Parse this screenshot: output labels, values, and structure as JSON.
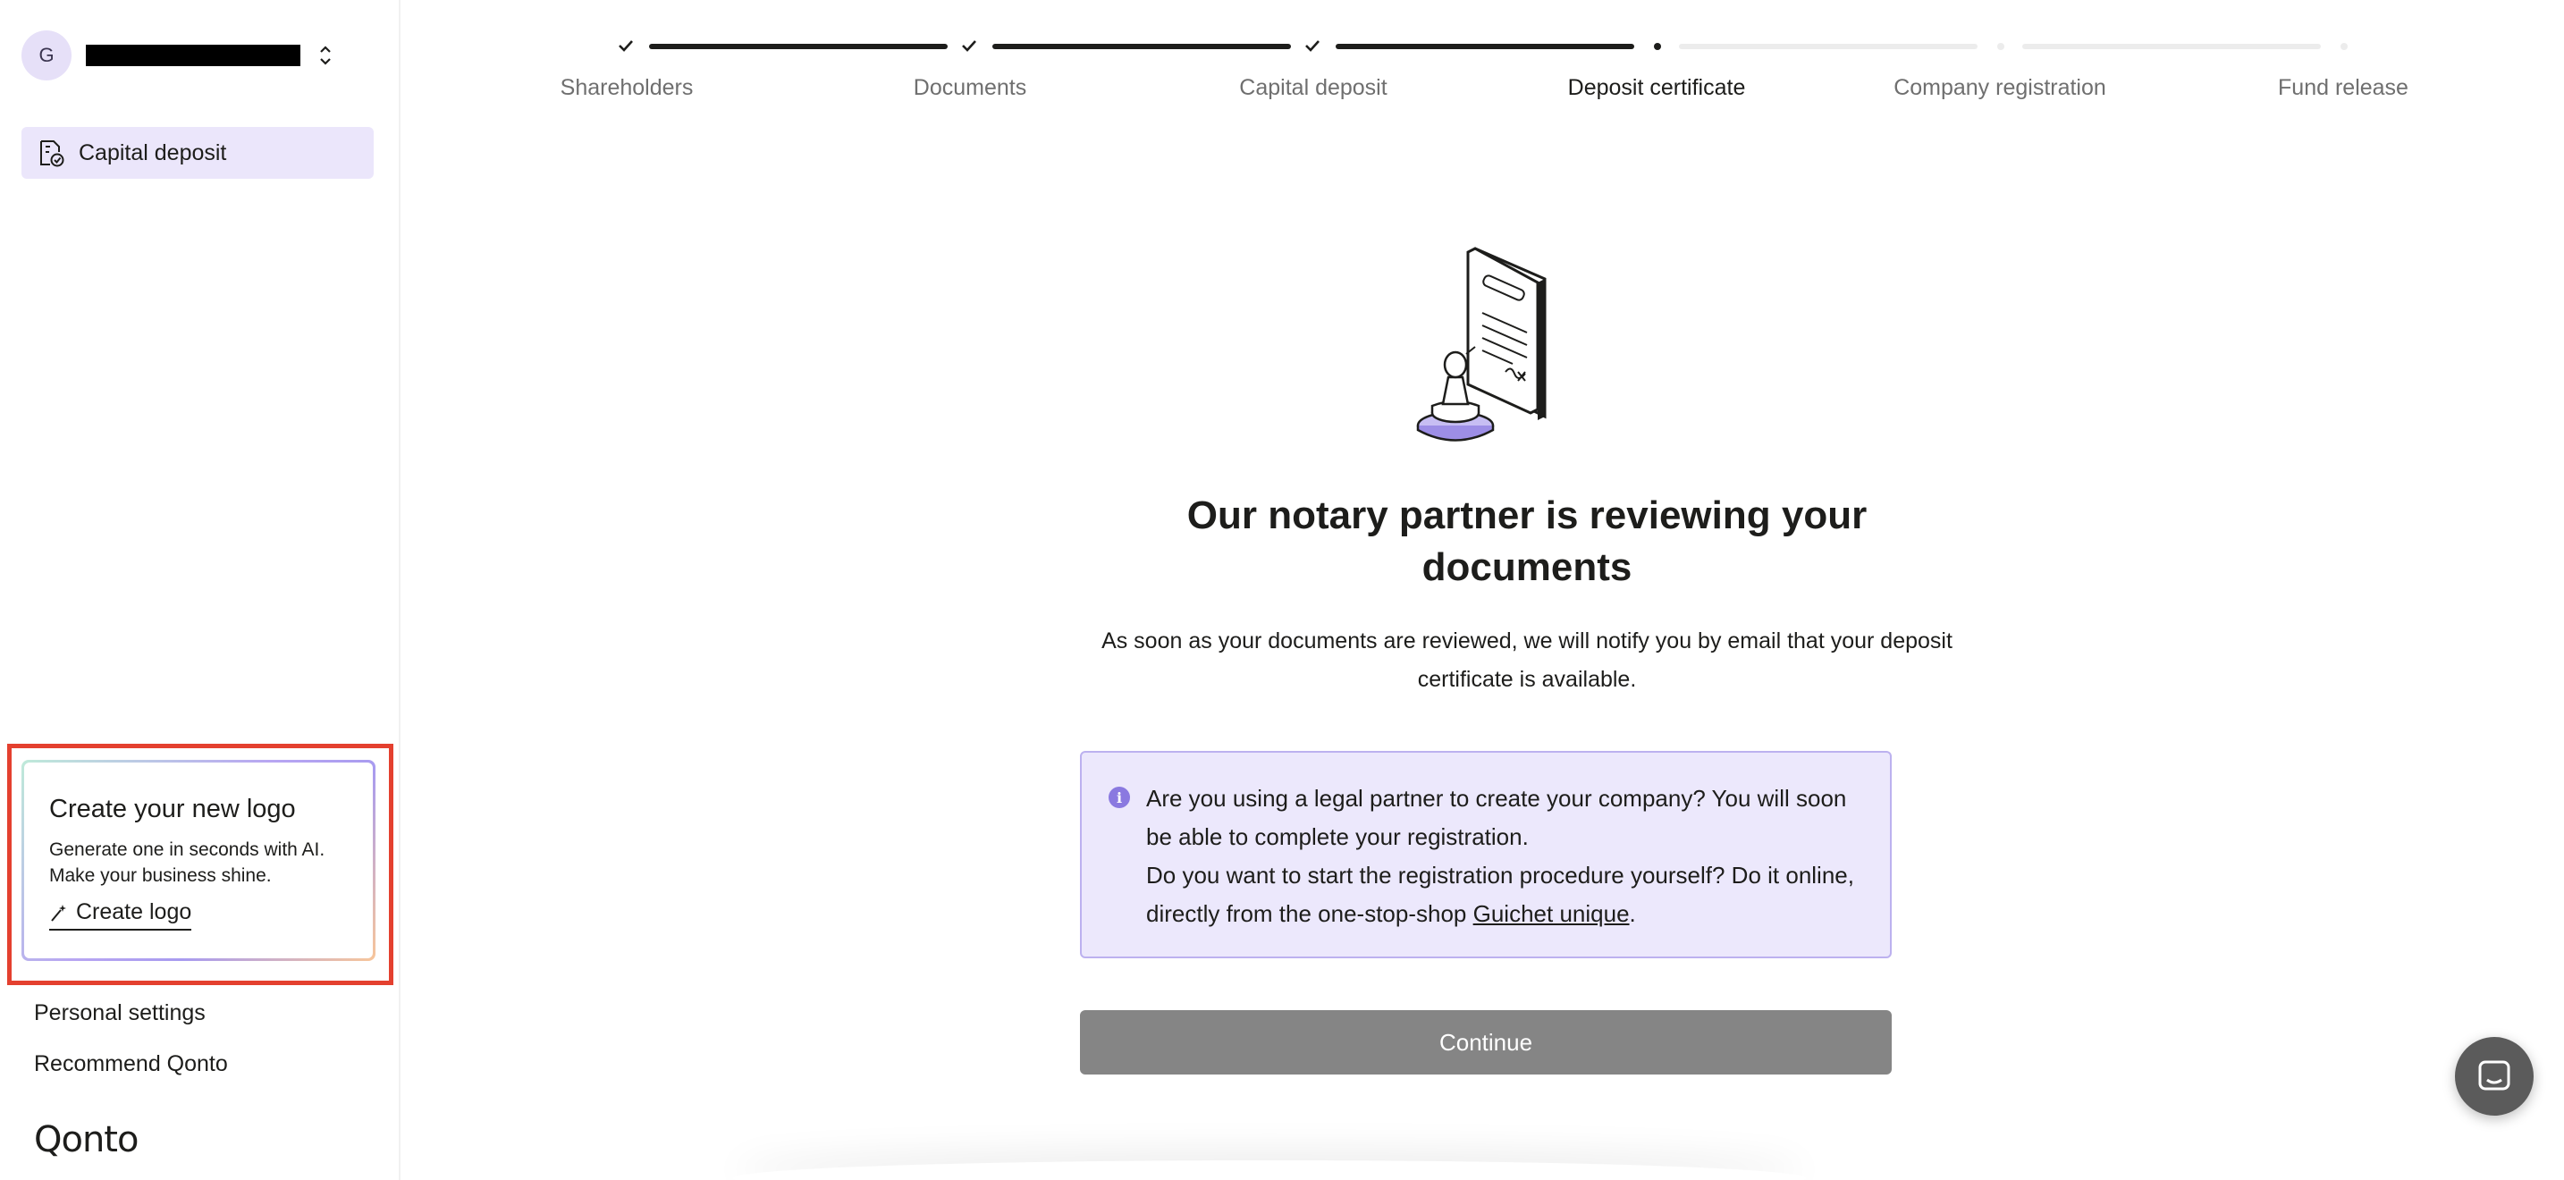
{
  "sidebar": {
    "avatar_initial": "G",
    "nav_items": [
      {
        "label": "Capital deposit",
        "icon": "document-badge-icon",
        "active": true
      }
    ],
    "promo": {
      "title": "Create your new logo",
      "text_line1": "Generate one in seconds with AI.",
      "text_line2": "Make your business shine.",
      "link_label": "Create logo",
      "link_icon": "magic-wand-icon"
    },
    "links": {
      "personal_settings": "Personal settings",
      "recommend": "Recommend Qonto"
    },
    "brand": "Qonto"
  },
  "stepper": {
    "steps": [
      {
        "label": "Shareholders",
        "status": "done"
      },
      {
        "label": "Documents",
        "status": "done"
      },
      {
        "label": "Capital deposit",
        "status": "done"
      },
      {
        "label": "Deposit certificate",
        "status": "current"
      },
      {
        "label": "Company registration",
        "status": "todo"
      },
      {
        "label": "Fund release",
        "status": "todo"
      }
    ]
  },
  "main": {
    "title": "Our notary partner is reviewing your documents",
    "description": "As soon as your documents are reviewed, we will notify you by email that your deposit certificate is available.",
    "info": {
      "line1": "Are you using a legal partner to create your company? You will soon be able to complete your registration.",
      "line2_prefix": "Do you want to start the registration procedure yourself? Do it online, directly from the one-stop-shop ",
      "link": "Guichet unique",
      "line2_suffix": "."
    },
    "continue_label": "Continue"
  },
  "colors": {
    "accent_light": "#ebe6fb",
    "info_bg": "#ece8fc",
    "info_border": "#bcb1ef",
    "button_disabled": "#858585",
    "highlight_red": "#e4402f"
  }
}
